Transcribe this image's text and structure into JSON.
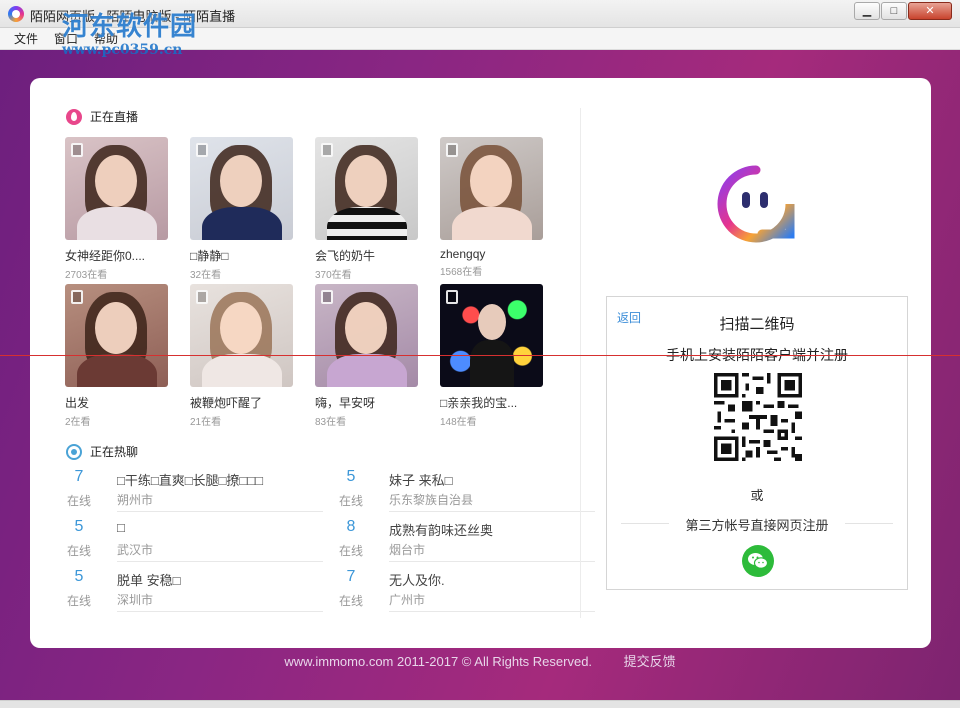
{
  "window": {
    "title": "陌陌网页版 - 陌陌电脑版 - 陌陌直播",
    "controls": {
      "minimize": "▁",
      "maximize": "□",
      "close": "✕"
    }
  },
  "menu": [
    "文件",
    "窗口",
    "帮助"
  ],
  "watermark": {
    "text": "河东软件园",
    "url": "www.pc0359.cn"
  },
  "live": {
    "heading": "正在直播",
    "streams": [
      {
        "name": "女神经距你0....",
        "viewers": "2703在看"
      },
      {
        "name": "□静静□",
        "viewers": "32在看"
      },
      {
        "name": "会飞的奶牛",
        "viewers": "370在看"
      },
      {
        "name": "zhengqy",
        "viewers": "1568在看"
      },
      {
        "name": "出发",
        "viewers": "2在看"
      },
      {
        "name": "被鞭炮吓醒了",
        "viewers": "21在看"
      },
      {
        "name": "嗨，早安呀",
        "viewers": "83在看"
      },
      {
        "name": "□亲亲我的宝...",
        "viewers": "148在看"
      }
    ]
  },
  "hot": {
    "heading": "正在热聊",
    "unit": "在线",
    "items": [
      {
        "count": "7",
        "title": "□干练□直爽□长腿□撩□□□",
        "city": "朔州市"
      },
      {
        "count": "5",
        "title": "妹子 来私□",
        "city": "乐东黎族自治县"
      },
      {
        "count": "5",
        "title": "□",
        "city": "武汉市"
      },
      {
        "count": "8",
        "title": "成熟有韵味还丝奥",
        "city": "烟台市"
      },
      {
        "count": "5",
        "title": "脱单 安稳□",
        "city": "深圳市"
      },
      {
        "count": "7",
        "title": "无人及你.",
        "city": "广州市"
      }
    ]
  },
  "login": {
    "back": "返回",
    "title": "扫描二维码",
    "subtitle": "手机上安装陌陌客户端并注册",
    "or": "或",
    "third_party": "第三方帐号直接网页注册"
  },
  "footer": {
    "copyright": "www.immomo.com 2011-2017 © All Rights Reserved.",
    "feedback": "提交反馈"
  },
  "colors": {
    "accent_blue": "#3c97d8",
    "wechat_green": "#2dbb3a",
    "live_pink": "#e8478b"
  }
}
